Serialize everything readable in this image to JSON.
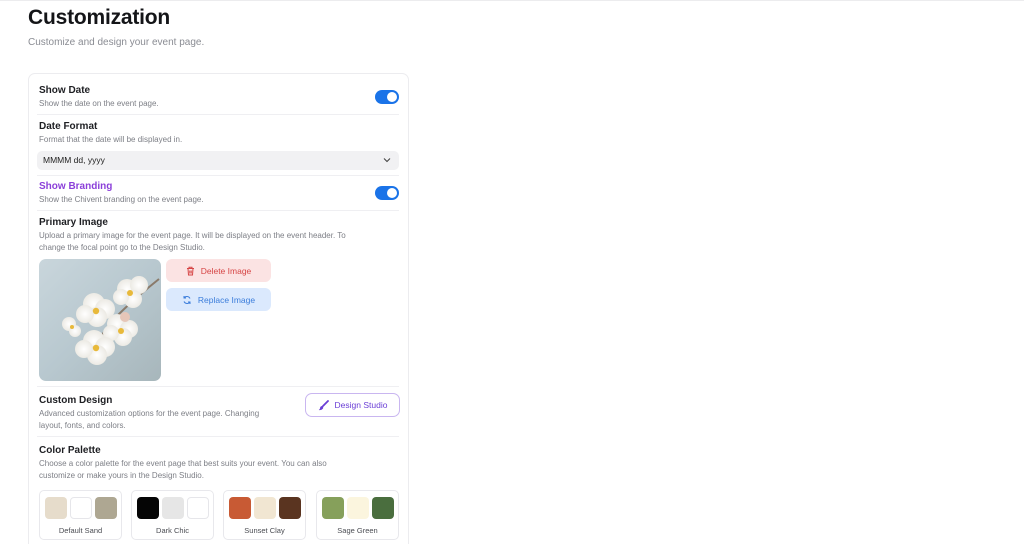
{
  "header": {
    "title": "Customization",
    "subtitle": "Customize and design your event page."
  },
  "settings": {
    "show_date": {
      "label": "Show Date",
      "description": "Show the date on the event page.",
      "enabled": true
    },
    "date_format": {
      "label": "Date Format",
      "description": "Format that the date will be displayed in.",
      "value": "MMMM dd, yyyy"
    },
    "show_branding": {
      "label": "Show Branding",
      "description": "Show the Chivent branding on the event page.",
      "enabled": true
    },
    "primary_image": {
      "label": "Primary Image",
      "description_line1": "Upload a primary image for the event page. It will be displayed on the event header. To",
      "description_line2": "change the focal point go to the Design Studio.",
      "delete_label": "Delete Image",
      "replace_label": "Replace Image"
    },
    "custom_design": {
      "label": "Custom Design",
      "description_line1": "Advanced customization options for the event page. Changing",
      "description_line2": "layout, fonts, and colors.",
      "button_label": "Design Studio"
    },
    "color_palette": {
      "label": "Color Palette",
      "description_line1": "Choose a color palette for the event page that best suits your event. You can also",
      "description_line2": "customize or make yours in the Design Studio.",
      "palettes": [
        {
          "name": "Default Sand",
          "colors": [
            "#e6dccb",
            "#ffffff",
            "#aea792"
          ]
        },
        {
          "name": "Dark Chic",
          "colors": [
            "#050505",
            "#e6e6e6",
            "#ffffff"
          ]
        },
        {
          "name": "Sunset Clay",
          "colors": [
            "#c85a34",
            "#f1e6d2",
            "#5a3420"
          ]
        },
        {
          "name": "Sage Green",
          "colors": [
            "#86a05b",
            "#fbf5de",
            "#4a6e3e"
          ]
        }
      ]
    }
  },
  "colors": {
    "accent": "#1a73e8",
    "branding_label": "#8b3fd9",
    "danger": "#d64545"
  },
  "icons": {
    "trash": "trash-icon",
    "refresh": "refresh-icon",
    "brush": "paintbrush-icon",
    "chevron": "chevron-down-icon"
  }
}
